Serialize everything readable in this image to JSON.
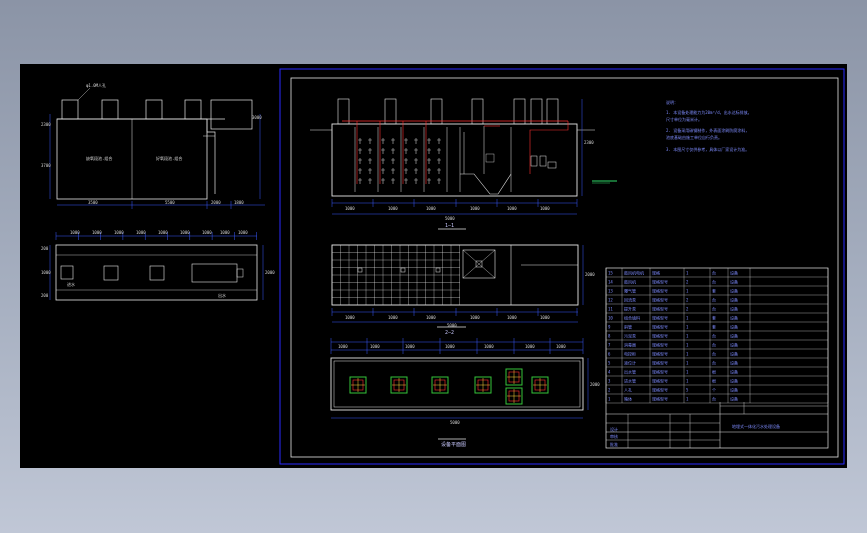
{
  "colors": {
    "background": "#000000",
    "frame": "#2a2aff",
    "outline": "#e6e6e6",
    "dimension": "#3b5bff",
    "pipe": "#ff3030",
    "grid": "#e6e6e6",
    "manhole": "#ffd33a",
    "manhole_inner": "#36c53a",
    "level_mark": "#2fdc6a"
  },
  "left_elevation": {
    "top_label": "φ1.0M人孔",
    "dims_left": [
      "2300",
      "3700"
    ],
    "dims_right": [
      "3000"
    ],
    "tank_labels": [
      "缺氧段池.组合",
      "好氧段池.组合"
    ],
    "dims_bottom": [
      "3500",
      "5500",
      "2000",
      "1800"
    ]
  },
  "left_plan": {
    "dims_top": [
      "1000",
      "1000",
      "1000",
      "1000",
      "1000",
      "1000",
      "1000",
      "1000",
      "1000"
    ],
    "dims_left": [
      "200",
      "1000",
      "200"
    ],
    "dims_right": [
      "2000"
    ],
    "labels": [
      "进水",
      "出水"
    ]
  },
  "section_a": {
    "dims_bottom": [
      "1000",
      "1000",
      "1000",
      "1000",
      "1000",
      "1000"
    ],
    "total": "5000",
    "dims_right": [
      "2300"
    ],
    "view_label": "1—1"
  },
  "plan_mid": {
    "dims_bottom": [
      "1000",
      "1000",
      "1000",
      "1000",
      "1000",
      "1000"
    ],
    "total": "5000",
    "dims_right": [
      "2000"
    ],
    "view_label": "2—2"
  },
  "plan_bottom": {
    "dims_top": [
      "1000",
      "1000",
      "1000",
      "1000",
      "1000",
      "1000",
      "1000"
    ],
    "total": "5000",
    "dims_right": [
      "2000"
    ],
    "view_label": "设备平面图"
  },
  "notes": {
    "heading": "说明：",
    "lines": [
      "1. 本设备处理能力为20m³/d，出水达标排放。",
      "   尺寸单位为毫米计。",
      "2. 设备采用碳钢制作，外表面涂刷防腐涂料，",
      "   池底基础由施工单位自行负责。",
      "3. 本图尺寸仅供参考，具体以厂家设计为准。"
    ]
  },
  "bom": {
    "rows": [
      [
        "15",
        "鼓风机电机",
        "规格",
        "1",
        "台",
        "设备"
      ],
      [
        "14",
        "鼓风机",
        "规格型号",
        "2",
        "台",
        "设备"
      ],
      [
        "13",
        "曝气管",
        "规格型号",
        "1",
        "套",
        "设备"
      ],
      [
        "12",
        "回流泵",
        "规格型号",
        "2",
        "台",
        "设备"
      ],
      [
        "11",
        "提升泵",
        "规格型号",
        "2",
        "台",
        "设备"
      ],
      [
        "10",
        "组合填料",
        "规格型号",
        "1",
        "套",
        "设备"
      ],
      [
        "9",
        "斜管",
        "规格型号",
        "1",
        "套",
        "设备"
      ],
      [
        "8",
        "污泥泵",
        "规格型号",
        "1",
        "台",
        "设备"
      ],
      [
        "7",
        "消毒器",
        "规格型号",
        "1",
        "台",
        "设备"
      ],
      [
        "6",
        "电控柜",
        "规格型号",
        "1",
        "台",
        "设备"
      ],
      [
        "5",
        "液位计",
        "规格型号",
        "1",
        "台",
        "设备"
      ],
      [
        "4",
        "出水管",
        "规格型号",
        "1",
        "根",
        "设备"
      ],
      [
        "3",
        "进水管",
        "规格型号",
        "1",
        "根",
        "设备"
      ],
      [
        "2",
        "人孔",
        "规格型号",
        "5",
        "个",
        "设备"
      ],
      [
        "1",
        "箱体",
        "规格型号",
        "1",
        "台",
        "设备"
      ]
    ],
    "title": "地埋式一体化污水处理设备",
    "sign_rows": [
      "设计",
      "审核",
      "批准"
    ]
  }
}
